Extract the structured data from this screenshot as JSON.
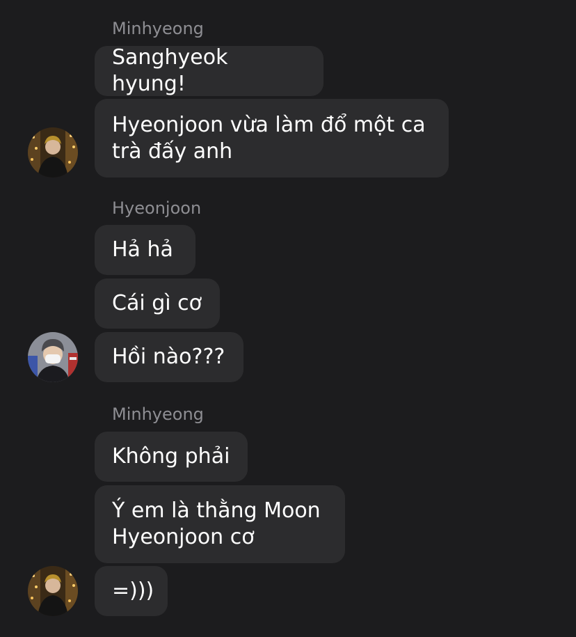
{
  "groups": [
    {
      "sender": "Minhyeong",
      "messages": [
        "Sanghyeok hyung!",
        "Hyeonjoon vừa làm đổ một ca\ntrà đấy anh"
      ],
      "avatar_icon": "user-avatar-minhyeong-icon"
    },
    {
      "sender": "Hyeonjoon",
      "messages": [
        "Hả hả",
        "Cái gì cơ",
        "Hồi nào???"
      ],
      "avatar_icon": "user-avatar-hyeonjoon-icon"
    },
    {
      "sender": "Minhyeong",
      "messages": [
        "Không phải",
        "Ý em là thằng Moon\nHyeonjoon cơ",
        "=)))"
      ],
      "avatar_icon": "user-avatar-minhyeong-icon"
    }
  ],
  "colors": {
    "background": "#1c1c1e",
    "bubble": "#2c2c2e",
    "sender_name": "#8e8e93",
    "message_text": "#ffffff"
  }
}
